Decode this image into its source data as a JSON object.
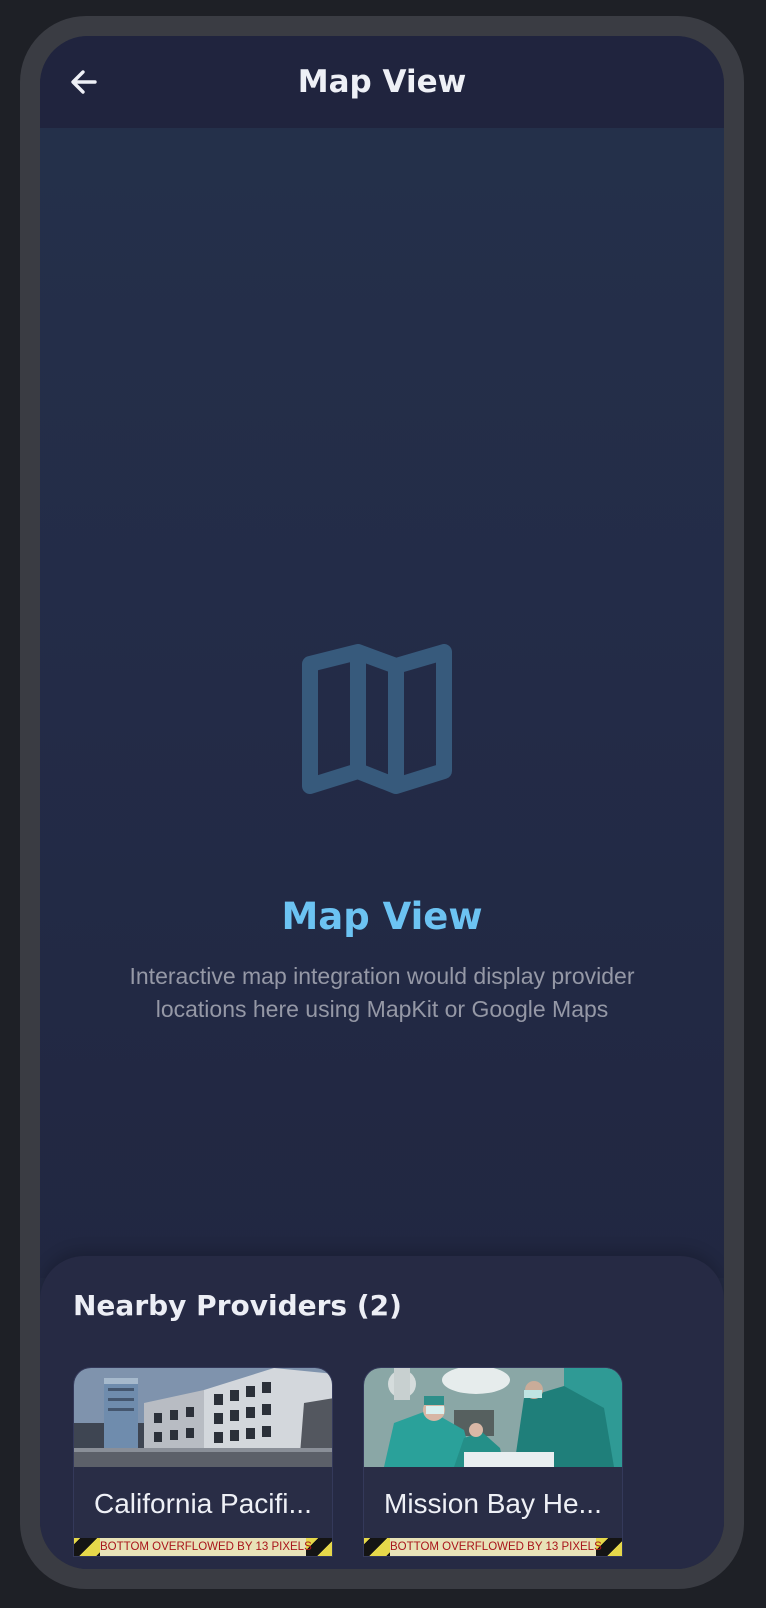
{
  "app_bar": {
    "title": "Map View",
    "back_icon": "arrow-left-icon"
  },
  "map_placeholder": {
    "icon": "map-icon",
    "heading": "Map View",
    "description": "Interactive map integration would display provider locations here using MapKit or Google Maps"
  },
  "nearby_providers": {
    "title": "Nearby Providers (2)",
    "providers": [
      {
        "name": "California Pacifi...",
        "image": "building-photo",
        "overflow_warning": "BOTTOM OVERFLOWED BY 13 PIXELS"
      },
      {
        "name": "Mission Bay He...",
        "image": "surgery-photo",
        "overflow_warning": "BOTTOM OVERFLOWED BY 13 PIXELS"
      }
    ]
  },
  "colors": {
    "background": "#232a43",
    "app_bar": "#20243e",
    "accent": "#6cc3f2",
    "sheet": "#262a44",
    "map_icon": "#375a7c"
  }
}
